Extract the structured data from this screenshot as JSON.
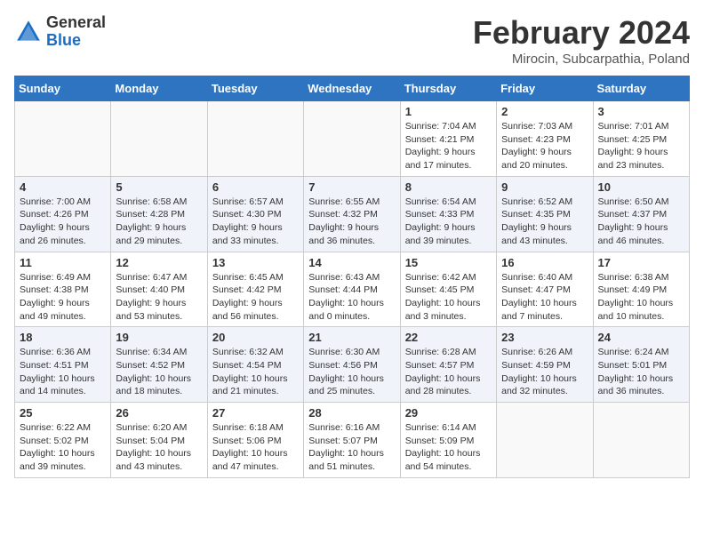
{
  "header": {
    "logo_general": "General",
    "logo_blue": "Blue",
    "title": "February 2024",
    "location": "Mirocin, Subcarpathia, Poland"
  },
  "days_of_week": [
    "Sunday",
    "Monday",
    "Tuesday",
    "Wednesday",
    "Thursday",
    "Friday",
    "Saturday"
  ],
  "weeks": [
    [
      {
        "day": "",
        "info": ""
      },
      {
        "day": "",
        "info": ""
      },
      {
        "day": "",
        "info": ""
      },
      {
        "day": "",
        "info": ""
      },
      {
        "day": "1",
        "info": "Sunrise: 7:04 AM\nSunset: 4:21 PM\nDaylight: 9 hours\nand 17 minutes."
      },
      {
        "day": "2",
        "info": "Sunrise: 7:03 AM\nSunset: 4:23 PM\nDaylight: 9 hours\nand 20 minutes."
      },
      {
        "day": "3",
        "info": "Sunrise: 7:01 AM\nSunset: 4:25 PM\nDaylight: 9 hours\nand 23 minutes."
      }
    ],
    [
      {
        "day": "4",
        "info": "Sunrise: 7:00 AM\nSunset: 4:26 PM\nDaylight: 9 hours\nand 26 minutes."
      },
      {
        "day": "5",
        "info": "Sunrise: 6:58 AM\nSunset: 4:28 PM\nDaylight: 9 hours\nand 29 minutes."
      },
      {
        "day": "6",
        "info": "Sunrise: 6:57 AM\nSunset: 4:30 PM\nDaylight: 9 hours\nand 33 minutes."
      },
      {
        "day": "7",
        "info": "Sunrise: 6:55 AM\nSunset: 4:32 PM\nDaylight: 9 hours\nand 36 minutes."
      },
      {
        "day": "8",
        "info": "Sunrise: 6:54 AM\nSunset: 4:33 PM\nDaylight: 9 hours\nand 39 minutes."
      },
      {
        "day": "9",
        "info": "Sunrise: 6:52 AM\nSunset: 4:35 PM\nDaylight: 9 hours\nand 43 minutes."
      },
      {
        "day": "10",
        "info": "Sunrise: 6:50 AM\nSunset: 4:37 PM\nDaylight: 9 hours\nand 46 minutes."
      }
    ],
    [
      {
        "day": "11",
        "info": "Sunrise: 6:49 AM\nSunset: 4:38 PM\nDaylight: 9 hours\nand 49 minutes."
      },
      {
        "day": "12",
        "info": "Sunrise: 6:47 AM\nSunset: 4:40 PM\nDaylight: 9 hours\nand 53 minutes."
      },
      {
        "day": "13",
        "info": "Sunrise: 6:45 AM\nSunset: 4:42 PM\nDaylight: 9 hours\nand 56 minutes."
      },
      {
        "day": "14",
        "info": "Sunrise: 6:43 AM\nSunset: 4:44 PM\nDaylight: 10 hours\nand 0 minutes."
      },
      {
        "day": "15",
        "info": "Sunrise: 6:42 AM\nSunset: 4:45 PM\nDaylight: 10 hours\nand 3 minutes."
      },
      {
        "day": "16",
        "info": "Sunrise: 6:40 AM\nSunset: 4:47 PM\nDaylight: 10 hours\nand 7 minutes."
      },
      {
        "day": "17",
        "info": "Sunrise: 6:38 AM\nSunset: 4:49 PM\nDaylight: 10 hours\nand 10 minutes."
      }
    ],
    [
      {
        "day": "18",
        "info": "Sunrise: 6:36 AM\nSunset: 4:51 PM\nDaylight: 10 hours\nand 14 minutes."
      },
      {
        "day": "19",
        "info": "Sunrise: 6:34 AM\nSunset: 4:52 PM\nDaylight: 10 hours\nand 18 minutes."
      },
      {
        "day": "20",
        "info": "Sunrise: 6:32 AM\nSunset: 4:54 PM\nDaylight: 10 hours\nand 21 minutes."
      },
      {
        "day": "21",
        "info": "Sunrise: 6:30 AM\nSunset: 4:56 PM\nDaylight: 10 hours\nand 25 minutes."
      },
      {
        "day": "22",
        "info": "Sunrise: 6:28 AM\nSunset: 4:57 PM\nDaylight: 10 hours\nand 28 minutes."
      },
      {
        "day": "23",
        "info": "Sunrise: 6:26 AM\nSunset: 4:59 PM\nDaylight: 10 hours\nand 32 minutes."
      },
      {
        "day": "24",
        "info": "Sunrise: 6:24 AM\nSunset: 5:01 PM\nDaylight: 10 hours\nand 36 minutes."
      }
    ],
    [
      {
        "day": "25",
        "info": "Sunrise: 6:22 AM\nSunset: 5:02 PM\nDaylight: 10 hours\nand 39 minutes."
      },
      {
        "day": "26",
        "info": "Sunrise: 6:20 AM\nSunset: 5:04 PM\nDaylight: 10 hours\nand 43 minutes."
      },
      {
        "day": "27",
        "info": "Sunrise: 6:18 AM\nSunset: 5:06 PM\nDaylight: 10 hours\nand 47 minutes."
      },
      {
        "day": "28",
        "info": "Sunrise: 6:16 AM\nSunset: 5:07 PM\nDaylight: 10 hours\nand 51 minutes."
      },
      {
        "day": "29",
        "info": "Sunrise: 6:14 AM\nSunset: 5:09 PM\nDaylight: 10 hours\nand 54 minutes."
      },
      {
        "day": "",
        "info": ""
      },
      {
        "day": "",
        "info": ""
      }
    ]
  ]
}
